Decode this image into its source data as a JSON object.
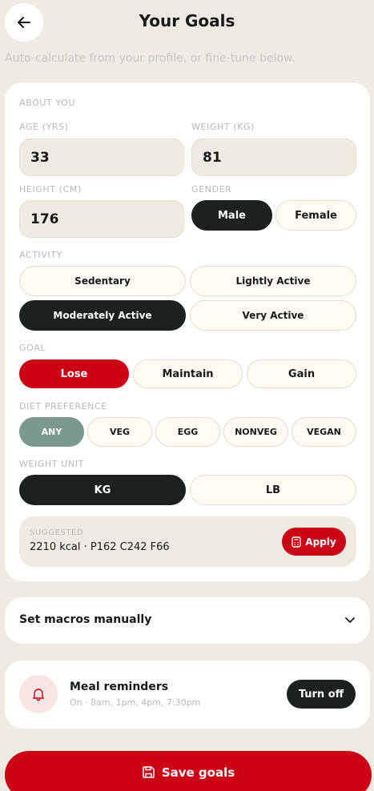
{
  "header": {
    "title": "Your Goals",
    "subtitle": "Auto-calculate from your profile, or fine-tune below."
  },
  "about": {
    "section_label": "ABOUT YOU",
    "age": {
      "label": "AGE (YRS)",
      "value": "33"
    },
    "weight": {
      "label": "WEIGHT (KG)",
      "value": "81"
    },
    "height": {
      "label": "HEIGHT (CM)",
      "value": "176"
    },
    "gender": {
      "label": "GENDER",
      "options": [
        "Male",
        "Female"
      ],
      "selected": "Male"
    }
  },
  "activity": {
    "label": "ACTIVITY",
    "options": [
      "Sedentary",
      "Lightly Active",
      "Moderately Active",
      "Very Active"
    ],
    "selected": "Moderately Active"
  },
  "goal": {
    "label": "GOAL",
    "options": [
      "Lose",
      "Maintain",
      "Gain"
    ],
    "selected": "Lose"
  },
  "diet": {
    "label": "DIET PREFERENCE",
    "options": [
      "ANY",
      "VEG",
      "EGG",
      "NONVEG",
      "VEGAN"
    ],
    "selected": "ANY"
  },
  "weight_unit": {
    "label": "WEIGHT UNIT",
    "options": [
      "KG",
      "LB"
    ],
    "selected": "KG"
  },
  "suggested": {
    "label": "SUGGESTED",
    "value": "2210 kcal · P162 C242 F66",
    "apply_label": "Apply"
  },
  "macros": {
    "label": "Set macros manually"
  },
  "reminders": {
    "title": "Meal reminders",
    "subtitle": "On · 8am, 1pm, 4pm, 7:30pm",
    "button_label": "Turn off"
  },
  "save": {
    "label": "Save goals"
  },
  "colors": {
    "accent_red": "#cc0217",
    "dark": "#1b211f",
    "sage": "#7b9990",
    "background": "#efebe3"
  },
  "icons": [
    "back-arrow-icon",
    "calculator-icon",
    "chevron-down-icon",
    "bell-icon",
    "save-icon"
  ]
}
